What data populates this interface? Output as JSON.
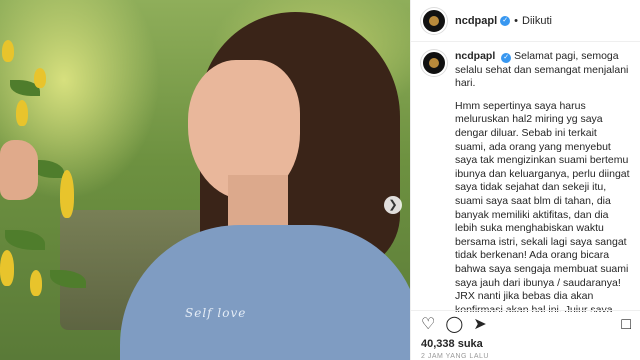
{
  "header": {
    "username": "ncdpapl",
    "separator": "•",
    "follow_status": "Diikuti"
  },
  "photo": {
    "shirt_text": "Self love"
  },
  "post": {
    "username": "ncdpapl",
    "paragraphs": [
      "Selamat pagi, semoga selalu sehat dan semangat menjalani hari.",
      "Hmm sepertinya saya harus meluruskan hal2 miring yg saya dengar diluar. Sebab ini terkait suami, ada orang yang menyebut saya tak mengizinkan suami bertemu ibunya dan keluarganya, perlu diingat saya tidak sejahat dan sekeji itu, suami saya saat blm di tahan, dia banyak memiliki aktifitas, dan dia lebih suka menghabiskan waktu bersama istri, sekali lagi saya sangat tidak berkenan! Ada orang bicara bahwa saya sengaja membuat suami saya jauh dari ibunya / saudaranya! JRX nanti jika bebas dia akan konfirmasi akan hal ini. Jujur saya merasa hina dan seolah jahat sekali menjadi istri. Mohon untuk yang"
    ]
  },
  "actions": {
    "likes": "40,338 suka",
    "timestamp": "2 JAM YANG LALU"
  },
  "icons": {
    "like": "heart-icon",
    "comment": "comment-icon",
    "share": "share-icon",
    "save": "bookmark-icon",
    "verified": "verified-icon",
    "next": "chevron-right-icon"
  },
  "colors": {
    "verified_blue": "#3897f0",
    "text": "#262626",
    "muted": "#999999"
  }
}
